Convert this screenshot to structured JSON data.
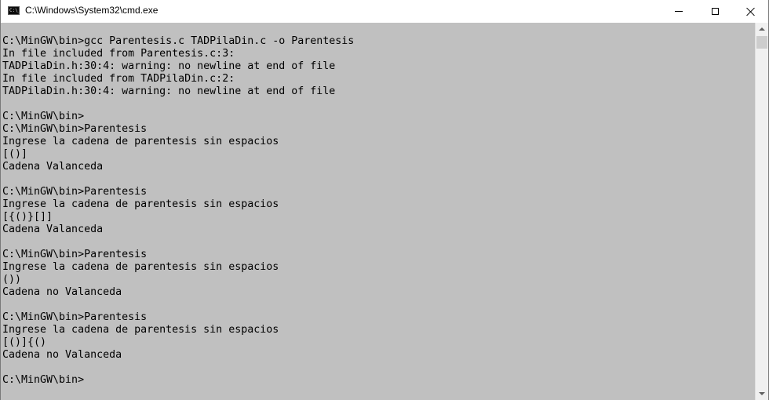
{
  "window": {
    "title": "C:\\Windows\\System32\\cmd.exe",
    "icon_label": "C:\\_"
  },
  "console": {
    "background": "#c0c0c0",
    "text_color": "#000000",
    "lines": [
      "C:\\MinGW\\bin>gcc Parentesis.c TADPilaDin.c -o Parentesis",
      "In file included from Parentesis.c:3:",
      "TADPilaDin.h:30:4: warning: no newline at end of file",
      "In file included from TADPilaDin.c:2:",
      "TADPilaDin.h:30:4: warning: no newline at end of file",
      "",
      "C:\\MinGW\\bin>",
      "C:\\MinGW\\bin>Parentesis",
      "Ingrese la cadena de parentesis sin espacios",
      "[()]",
      "Cadena Valanceda",
      "",
      "C:\\MinGW\\bin>Parentesis",
      "Ingrese la cadena de parentesis sin espacios",
      "[{()}[]]",
      "Cadena Valanceda",
      "",
      "C:\\MinGW\\bin>Parentesis",
      "Ingrese la cadena de parentesis sin espacios",
      "())",
      "Cadena no Valanceda",
      "",
      "C:\\MinGW\\bin>Parentesis",
      "Ingrese la cadena de parentesis sin espacios",
      "[()]{()",
      "Cadena no Valanceda",
      "",
      "C:\\MinGW\\bin>"
    ]
  }
}
